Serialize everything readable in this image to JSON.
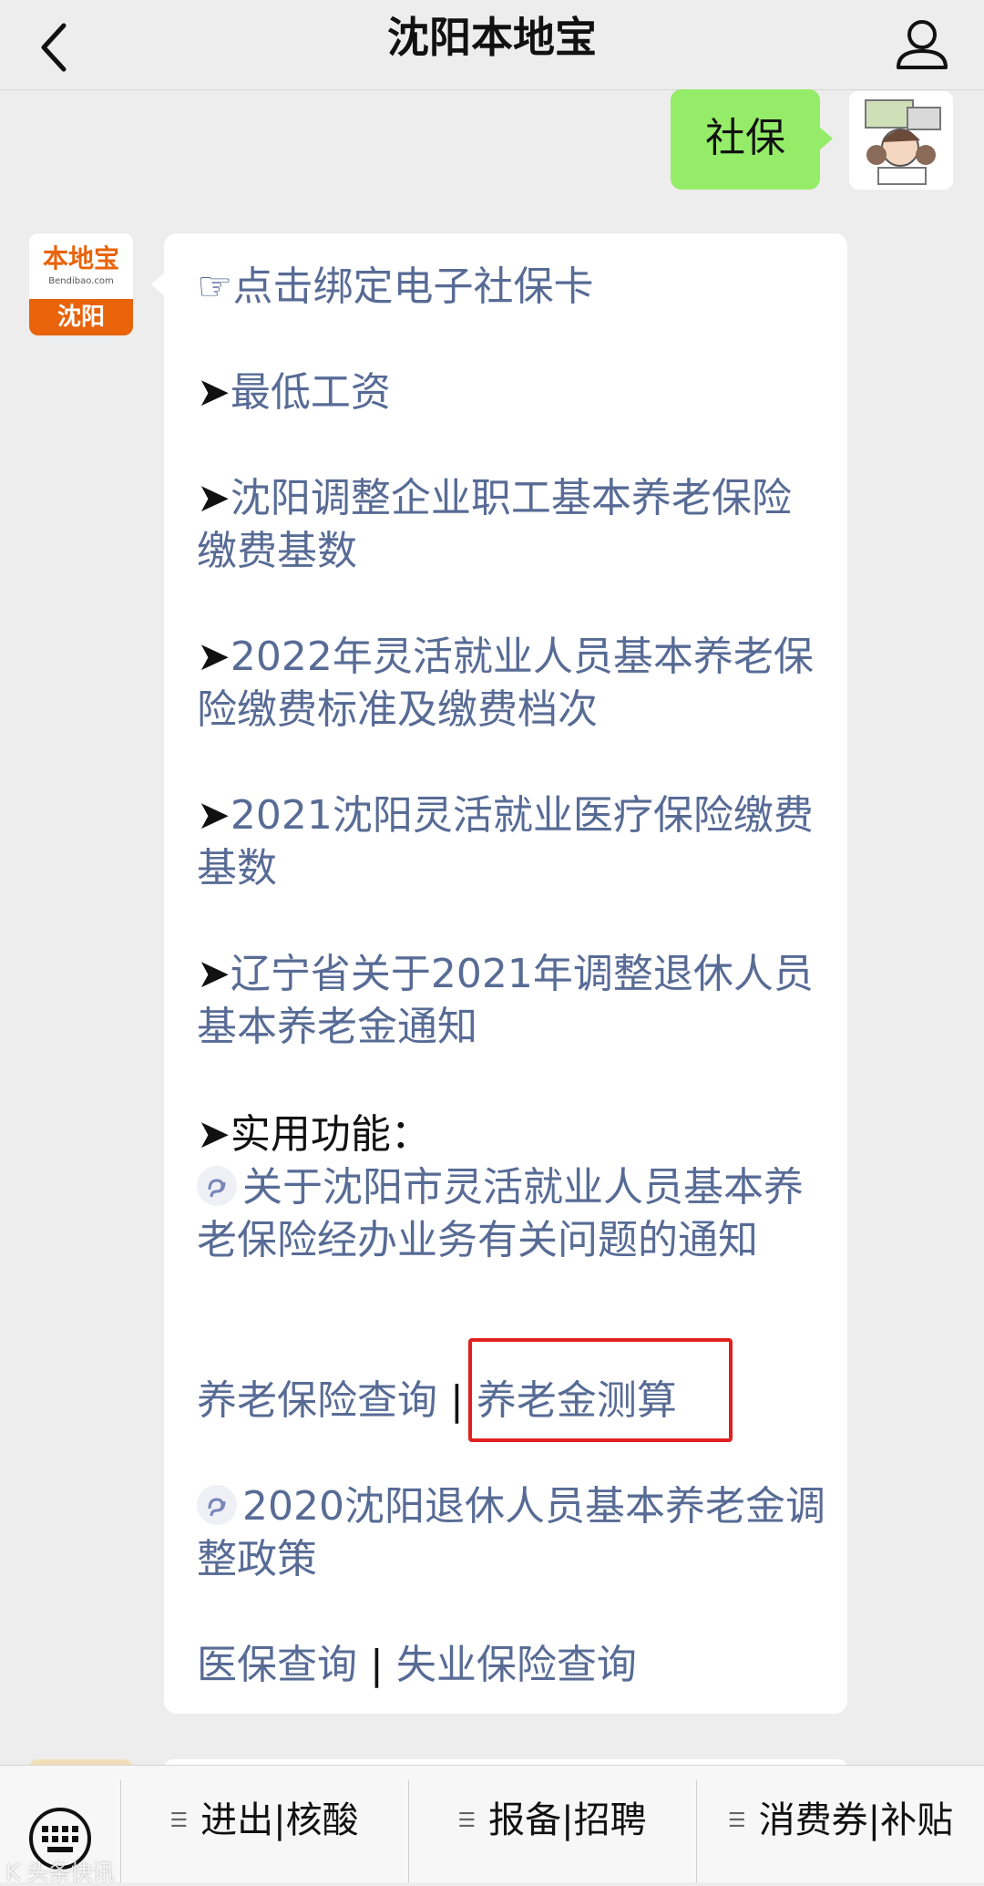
{
  "header": {
    "title": "沈阳本地宝"
  },
  "user_message": {
    "text": "社保"
  },
  "bot_avatar": {
    "brand": "本地宝",
    "domain": "Bendibao.com",
    "city": "沈阳"
  },
  "bot_message": {
    "bind_card_link": "☞点击绑定电子社保卡",
    "items": [
      {
        "arrow": "➤",
        "text": "最低工资"
      },
      {
        "arrow": "➤",
        "text": "沈阳调整企业职工基本养老保险缴费基数"
      },
      {
        "arrow": "➤",
        "text": "2022年灵活就业人员基本养老保险缴费标准及缴费档次"
      },
      {
        "arrow": "➤",
        "text": "2021沈阳灵活就业医疗保险缴费基数"
      },
      {
        "arrow": "➤",
        "text": "辽宁省关于2021年调整退休人员基本养老金通知"
      }
    ],
    "functions_heading": "➤实用功能：",
    "mini_link_1": "关于沈阳市灵活就业人员基本养老保险经办业务有关问题的通知",
    "pension_query": "养老保险查询",
    "separator": "|",
    "pension_calc": "养老金测算",
    "mini_link_2": "2020沈阳退休人员基本养老金调整政策",
    "medical_query": "医保查询",
    "unemployment_query": "失业保险查询"
  },
  "bottom_menu": {
    "items": [
      {
        "label": "进出|核酸"
      },
      {
        "label": "报备|招聘"
      },
      {
        "label": "消费券|补贴"
      }
    ]
  },
  "watermark": "K 头条快讯",
  "colors": {
    "link": "#576b95",
    "user_bubble": "#95ec69",
    "highlight": "#e02020",
    "brand_orange": "#e8630a"
  }
}
